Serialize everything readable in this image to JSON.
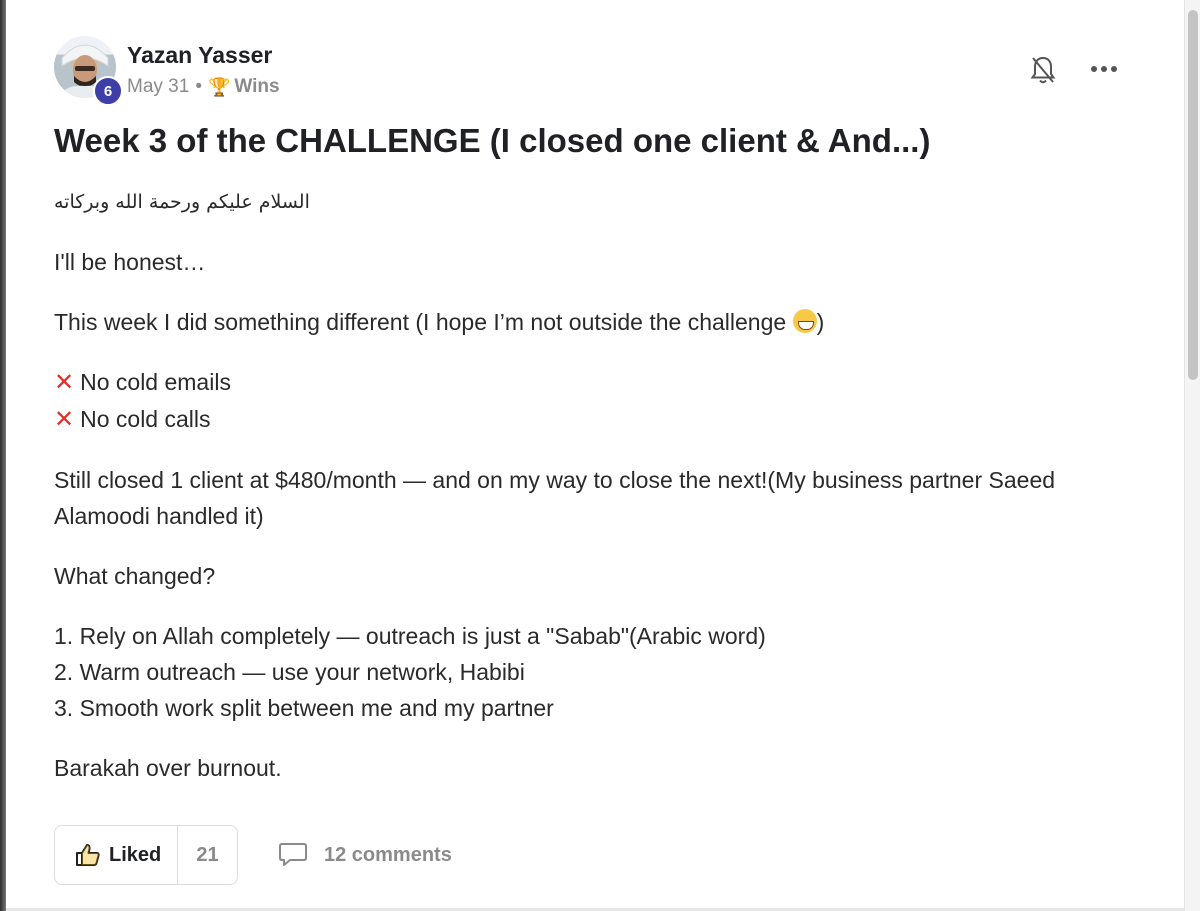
{
  "post": {
    "author": "Yazan Yasser",
    "level": "6",
    "date": "May 31",
    "separator": "•",
    "category_icon": "trophy-icon",
    "category": "Wins",
    "title": "Week 3 of the CHALLENGE (I closed one client & And...)",
    "greeting": "السلام عليكم ورحمة الله وبركاته",
    "paragraph_1": "I'll be honest…",
    "paragraph_2": "This week I did something different (I hope I’m not outside the challenge ",
    "paragraph_2_end": ")",
    "list_x": [
      "No cold emails",
      "No cold calls"
    ],
    "paragraph_3": "Still closed 1 client at $480/month — and on my way to close the next!(My business partner Saeed Alamoodi handled it)",
    "paragraph_4": "What changed?",
    "numbered": [
      "1. Rely on Allah completely — outreach is just a \"Sabab\"(Arabic word)",
      "2. Warm outreach — use your network, Habibi",
      "3. Smooth work split between me and my partner"
    ],
    "paragraph_5": "Barakah over burnout."
  },
  "footer": {
    "like_label": "Liked",
    "like_count": "21",
    "comments_label": "12 comments"
  },
  "colors": {
    "badge": "#3d3fa6",
    "cross": "#e0302a",
    "trophy": "#c9a227",
    "muted": "#8a8a8a"
  }
}
